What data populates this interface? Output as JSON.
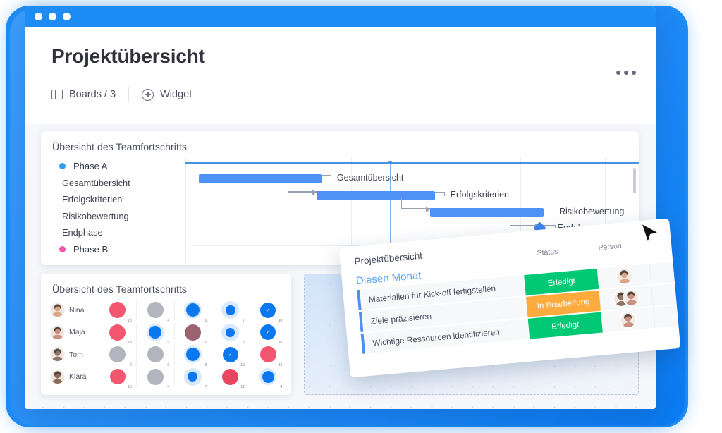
{
  "window": {
    "title_bar_color": "#1e8cf5",
    "dots": 3
  },
  "header": {
    "page_title": "Projektübersicht",
    "menu_icon": "kebab-menu-icon",
    "toolbar": {
      "boards_label": "Boards / 3",
      "boards_icon": "board-layout-icon",
      "add_icon": "plus-circle-icon",
      "widget_label": "Widget"
    }
  },
  "gantt": {
    "title": "Übersicht des Teamfortschritts",
    "rows": [
      {
        "label": "Phase A",
        "type": "phase",
        "color": "#2f9df4"
      },
      {
        "label": "Gesamtübersicht",
        "type": "task"
      },
      {
        "label": "Erfolgskriterien",
        "type": "task"
      },
      {
        "label": "Risikobewertung",
        "type": "task"
      },
      {
        "label": "Endphase",
        "type": "task"
      },
      {
        "label": "Phase B",
        "type": "phase",
        "color": "#f952a8"
      }
    ],
    "bars": [
      {
        "label": "Gesamtübersicht",
        "start_pct": 3,
        "width_pct": 27,
        "type": "bar"
      },
      {
        "label": "Erfolgskriterien",
        "start_pct": 29,
        "width_pct": 26,
        "type": "bar"
      },
      {
        "label": "Risikobewertung",
        "start_pct": 54,
        "width_pct": 25,
        "type": "bar"
      },
      {
        "label": "Endphase",
        "start_pct": 78,
        "width_pct": 0,
        "type": "milestone"
      }
    ],
    "bar_color": "#4f92f7",
    "today_marker": true
  },
  "team": {
    "title": "Übersicht des Teamfortschritts",
    "members": [
      {
        "name": "Nina",
        "avatar_tone": "#d9a68a"
      },
      {
        "name": "Maja",
        "avatar_tone": "#c98f7f"
      },
      {
        "name": "Tom",
        "avatar_tone": "#8d7566"
      },
      {
        "name": "Klara",
        "avatar_tone": "#8a6a58"
      }
    ],
    "cells": [
      [
        {
          "color": "#f3566f",
          "size": 23,
          "halo": 0,
          "check": false,
          "value": "13"
        },
        {
          "color": "#b2b5bd",
          "size": 23,
          "halo": 0,
          "check": false,
          "value": "4"
        },
        {
          "color": "#0b78f0",
          "size": 19,
          "halo": 25,
          "check": false,
          "value": "9"
        },
        {
          "color": "#0b78f0",
          "size": 14,
          "halo": 25,
          "check": false,
          "value": "7"
        },
        {
          "color": "#0b78f0",
          "size": 22,
          "halo": 0,
          "check": true,
          "value": "10"
        }
      ],
      [
        {
          "color": "#f3566f",
          "size": 23,
          "halo": 0,
          "check": false,
          "value": "13"
        },
        {
          "color": "#0b78f0",
          "size": 18,
          "halo": 25,
          "check": false,
          "value": "9"
        },
        {
          "color": "#9b6272",
          "size": 23,
          "halo": 0,
          "check": false,
          "value": "0"
        },
        {
          "color": "#0b78f0",
          "size": 13,
          "halo": 25,
          "check": false,
          "value": "7"
        },
        {
          "color": "#0b78f0",
          "size": 22,
          "halo": 0,
          "check": true,
          "value": "10"
        }
      ],
      [
        {
          "color": "#b2b5bd",
          "size": 23,
          "halo": 0,
          "check": false,
          "value": "0"
        },
        {
          "color": "#b2b5bd",
          "size": 23,
          "halo": 0,
          "check": false,
          "value": "0"
        },
        {
          "color": "#0b78f0",
          "size": 19,
          "halo": 25,
          "check": false,
          "value": "9"
        },
        {
          "color": "#0b78f0",
          "size": 22,
          "halo": 0,
          "check": true,
          "value": "10"
        },
        {
          "color": "#f3566f",
          "size": 23,
          "halo": 0,
          "check": false,
          "value": "12"
        }
      ],
      [
        {
          "color": "#f3566f",
          "size": 22,
          "halo": 0,
          "check": false,
          "value": "13"
        },
        {
          "color": "#b2b5bd",
          "size": 23,
          "halo": 0,
          "check": false,
          "value": "4"
        },
        {
          "color": "#0b78f0",
          "size": 14,
          "halo": 25,
          "check": false,
          "value": "7"
        },
        {
          "color": "#e8455f",
          "size": 23,
          "halo": 0,
          "check": false,
          "value": "12"
        },
        {
          "color": "#0b78f0",
          "size": 17,
          "halo": 24,
          "check": false,
          "value": "4"
        }
      ]
    ]
  },
  "float_card": {
    "title": "Projektübersicht",
    "columns": {
      "status": "Status",
      "person": "Person",
      "add_icon": "plus-circle-icon"
    },
    "group_label": "Diesen Monat",
    "rows": [
      {
        "name": "Materialien für Kick-off fertigstellen",
        "status": "Erledigt",
        "status_color": "#00c875",
        "people": 1
      },
      {
        "name": "Ziele präzisieren",
        "status": "In Bearbeitung",
        "status_color": "#fdab3d",
        "people": 2
      },
      {
        "name": "Wichtige Ressourcen identifizieren",
        "status": "Erledigt",
        "status_color": "#00c875",
        "people": 1
      }
    ]
  },
  "cursor": {
    "icon": "mouse-pointer-icon"
  }
}
